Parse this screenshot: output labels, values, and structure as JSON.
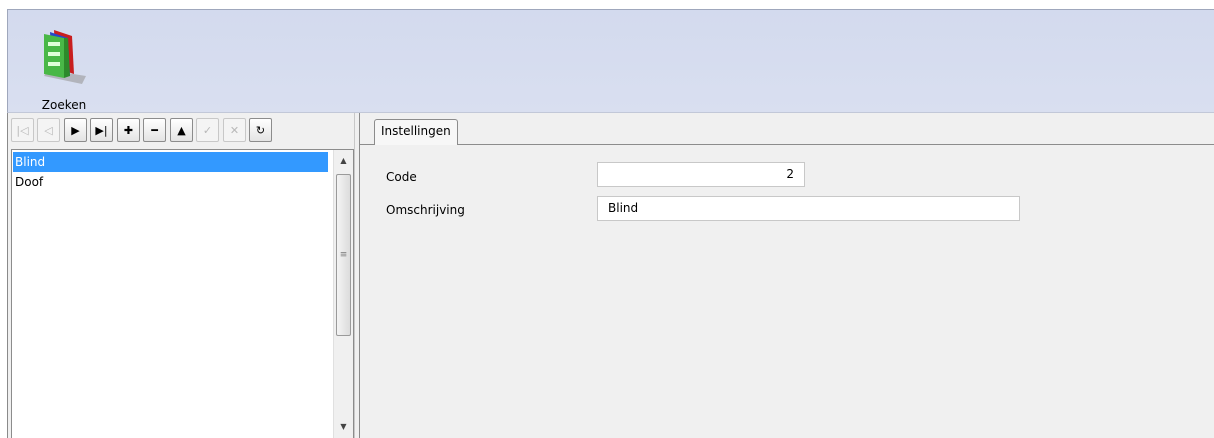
{
  "ribbon": {
    "search_label": "Zoeken",
    "icon": "books-icon"
  },
  "navigator": {
    "buttons": [
      {
        "name": "first-record-button",
        "icon": "first-icon",
        "glyph": "|◁",
        "enabled": false
      },
      {
        "name": "prior-record-button",
        "icon": "prior-icon",
        "glyph": "◁",
        "enabled": false
      },
      {
        "name": "next-record-button",
        "icon": "next-icon",
        "glyph": "▶",
        "enabled": true
      },
      {
        "name": "last-record-button",
        "icon": "last-icon",
        "glyph": "▶|",
        "enabled": true
      },
      {
        "name": "insert-record-button",
        "icon": "plus-icon",
        "glyph": "✚",
        "enabled": true
      },
      {
        "name": "delete-record-button",
        "icon": "minus-icon",
        "glyph": "━",
        "enabled": true
      },
      {
        "name": "edit-record-button",
        "icon": "up-triangle-icon",
        "glyph": "▲",
        "enabled": true
      },
      {
        "name": "post-record-button",
        "icon": "check-icon",
        "glyph": "✓",
        "enabled": false
      },
      {
        "name": "cancel-record-button",
        "icon": "cancel-icon",
        "glyph": "✕",
        "enabled": false
      },
      {
        "name": "refresh-button",
        "icon": "refresh-icon",
        "glyph": "↻",
        "enabled": true
      }
    ]
  },
  "list": {
    "items": [
      "Blind",
      "Doof"
    ],
    "selected_index": 0
  },
  "tabs": [
    {
      "label": "Instellingen"
    }
  ],
  "form": {
    "code_label": "Code",
    "code_value": "2",
    "description_label": "Omschrijving",
    "description_value": "Blind"
  },
  "colors": {
    "selection": "#3399ff",
    "ribbon": "#d3daee",
    "panel": "#f0f0f0"
  }
}
